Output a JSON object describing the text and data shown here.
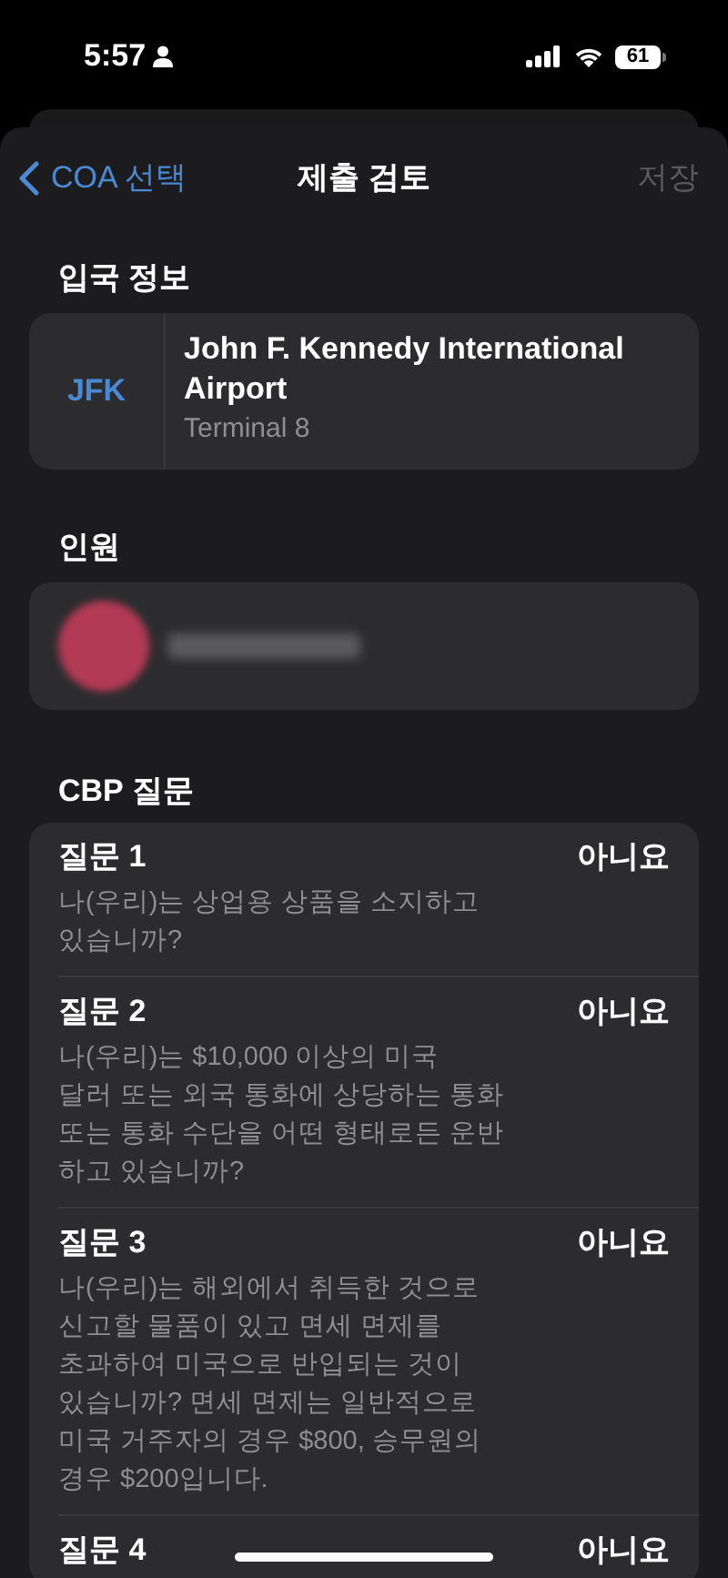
{
  "status_bar": {
    "time": "5:57",
    "battery": "61"
  },
  "nav": {
    "back": "COA 선택",
    "title": "제출 검토",
    "save": {
      "label": "저장",
      "disabled": true
    }
  },
  "entry": {
    "heading": "입국 정보",
    "code": "JFK",
    "airport": "John F. Kennedy International Airport",
    "terminal": "Terminal 8"
  },
  "people": {
    "heading": "인원"
  },
  "cbp": {
    "heading": "CBP 질문",
    "questions": [
      {
        "title": "질문 1",
        "answer": "아니요",
        "text": "나(우리)는 상업용 상품을 소지하고\n있습니까?"
      },
      {
        "title": "질문 2",
        "answer": "아니요",
        "text": "나(우리)는 $10,000 이상의 미국\n달러 또는 외국 통화에 상당하는 통화\n또는 통화 수단을 어떤 형태로든 운반\n하고 있습니까?"
      },
      {
        "title": "질문 3",
        "answer": "아니요",
        "text": "나(우리)는 해외에서 취득한 것으로\n신고할 물품이 있고 면세 면제를\n초과하여 미국으로 반입되는 것이\n있습니까? 면세 면제는 일반적으로\n미국 거주자의 경우 $800, 승무원의\n경우 $200입니다."
      },
      {
        "title": "질문 4",
        "answer": "아니요"
      }
    ]
  }
}
